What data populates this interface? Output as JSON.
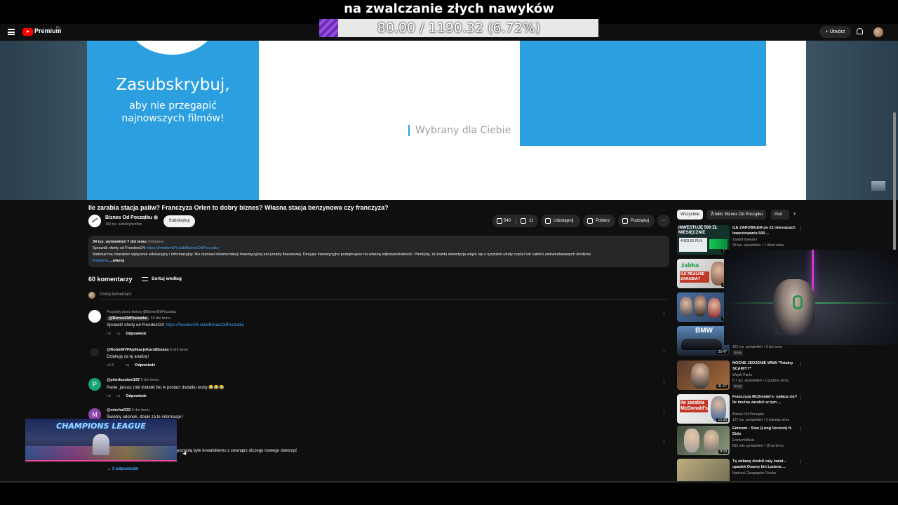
{
  "overlay": {
    "title": "na zwalczanie złych nawyków",
    "progress_text": "80.00 / 1190.32 (6.72%)",
    "progress_fraction": 0.0672
  },
  "header": {
    "brand": "Premium",
    "country": "PL",
    "create_label": "Utwórz",
    "icons": [
      "menu-icon",
      "youtube-logo-icon",
      "bell-icon",
      "avatar"
    ]
  },
  "video": {
    "subscribe_title": "Zasubskrybuj,",
    "subscribe_line1": "aby nie przegapić",
    "subscribe_line2": "najnowszych filmów!",
    "chosen_text": "Wybrany dla Ciebie",
    "colors": {
      "accent": "#2b9fe0"
    }
  },
  "meta": {
    "title": "Ile zarabia stacja paliw? Franczyza Orlen to dobry biznes? Własna stacja benzynowa czy franczyza?",
    "channel": "Biznes Od Początku",
    "subs": "160 tys. subskrybentów",
    "subscribe_btn": "Subskrybuj",
    "likes": "540",
    "dislikes": "11",
    "share": "Udostępnij",
    "download": "Pobierz",
    "thanks": "Podziękuj",
    "more": "···"
  },
  "description": {
    "stats": "34 tys. wyświetleń  7 dni temu",
    "tag": "#reklama",
    "offer": "Sprawdź ofertę od Freedom24:",
    "link": "https://freedom24.club/BiznesOdPoczatku",
    "disclaimer": "Materiał ma charakter wyłącznie edukacyjny i informacyjny. Nie stanowi rekomendacji inwestycyjnej ani porady finansowej. Decyzje inwestycyjne podejmujesz na własną odpowiedzialność. Pamiętaj, że każda inwestycja wiąże się z ryzykiem utraty części lub całości zainwestowanych środków.",
    "tag2": "#reklama",
    "more": "...więcej"
  },
  "comments": {
    "count": "60 komentarzy",
    "sort": "Sortuj według",
    "add_placeholder": "Dodaj komentarz",
    "reply_label": "Odpowiedz",
    "replies_link": "3 odpowiedzi",
    "items": [
      {
        "pinned": "Przypięty przez twórcę @BiznesOdPoczatku",
        "author": "@BiznesOdPoczatku",
        "time": "10 dni temu",
        "text_prefix": "Sprawdź ofertę od Freedom24:",
        "link": "https://freedom24.club/BiznesOdPoczatku",
        "likes": ""
      },
      {
        "author": "@RobieMVPAplikacjeKarolBocian",
        "time": "6 dni temu",
        "text": "Dziękuję za tę analizę!",
        "likes": "5"
      },
      {
        "author": "@piotrkundzel187",
        "time": "5 dni temu",
        "text": "Panie, janusz robi dodatki bio w postaci dodatku wody 😂😂😂",
        "likes": "",
        "avatar_letter": "P"
      },
      {
        "author": "@mirchal333",
        "time": "6 dni temu",
        "text": "Świetny odcinek, dzięki za te informacje !",
        "likes": "",
        "avatar_letter": "M"
      },
      {
        "text": "pozwolą byle kowalskiemu z zewnątrz niczego nowego otworzyć"
      }
    ]
  },
  "sidebar": {
    "chips": [
      "Wszystkie",
      "Źródło: Biznes Od Początku",
      "Pod"
    ],
    "recs": [
      {
        "title": "ILE ZAROBIŁEM po 22 miesiącach Inwestowania 500 ...",
        "channel": "Zawód Inwestor",
        "meta": "39 tys. wyświetleń • 1 dzień temu",
        "duration": "19",
        "thumb_text": "INWESTUJĘ 500 ZŁ MIESIĘCZNIE",
        "thumb_sub": "4 863,91 PLN"
      },
      {
        "title": "",
        "channel": "",
        "meta": "",
        "duration": "12",
        "thumb_text": "żabka",
        "thumb_sub": "ILE REALNIE ZARABIA?"
      },
      {
        "title": "",
        "channel": "",
        "meta": "",
        "duration": "16"
      },
      {
        "title": "",
        "channel": "",
        "meta": "122 tys. wyświetleń • 3 dni temu",
        "badge": "Nowy",
        "duration": "25:47",
        "thumb_text": "BMW"
      },
      {
        "title": "NOCNE JEDZENIE WWA *Totalny SCAM?!?*",
        "channel": "Wujek Paolo",
        "meta": "8,7 tys. wyświetleń • 2 godziny temu",
        "badge": "Nowy",
        "duration": "31:27"
      },
      {
        "title": "Franczyza McDonald's- opłaca się? Ile można zarobić w tym ...",
        "channel": "Biznes Od Początku",
        "meta": "127 tys. wyświetleń • 1 miesiąc temu",
        "duration": "12:03",
        "thumb_text": "Ile zarabia McDonald's"
      },
      {
        "title": "Eminem - Stan (Long Version) ft. Dido",
        "channel": "EminemMusic",
        "meta": "816 mln wyświetleń • 15 lat temu",
        "duration": "8:09"
      },
      {
        "title": "Tę obławę śledził cały świat – upadek Osamy bin Ladena ...",
        "channel": "National Geographic Polska",
        "meta": "",
        "duration": ""
      }
    ]
  },
  "stream": {
    "cl_title": "CHAMPIONS LEAGUE"
  }
}
